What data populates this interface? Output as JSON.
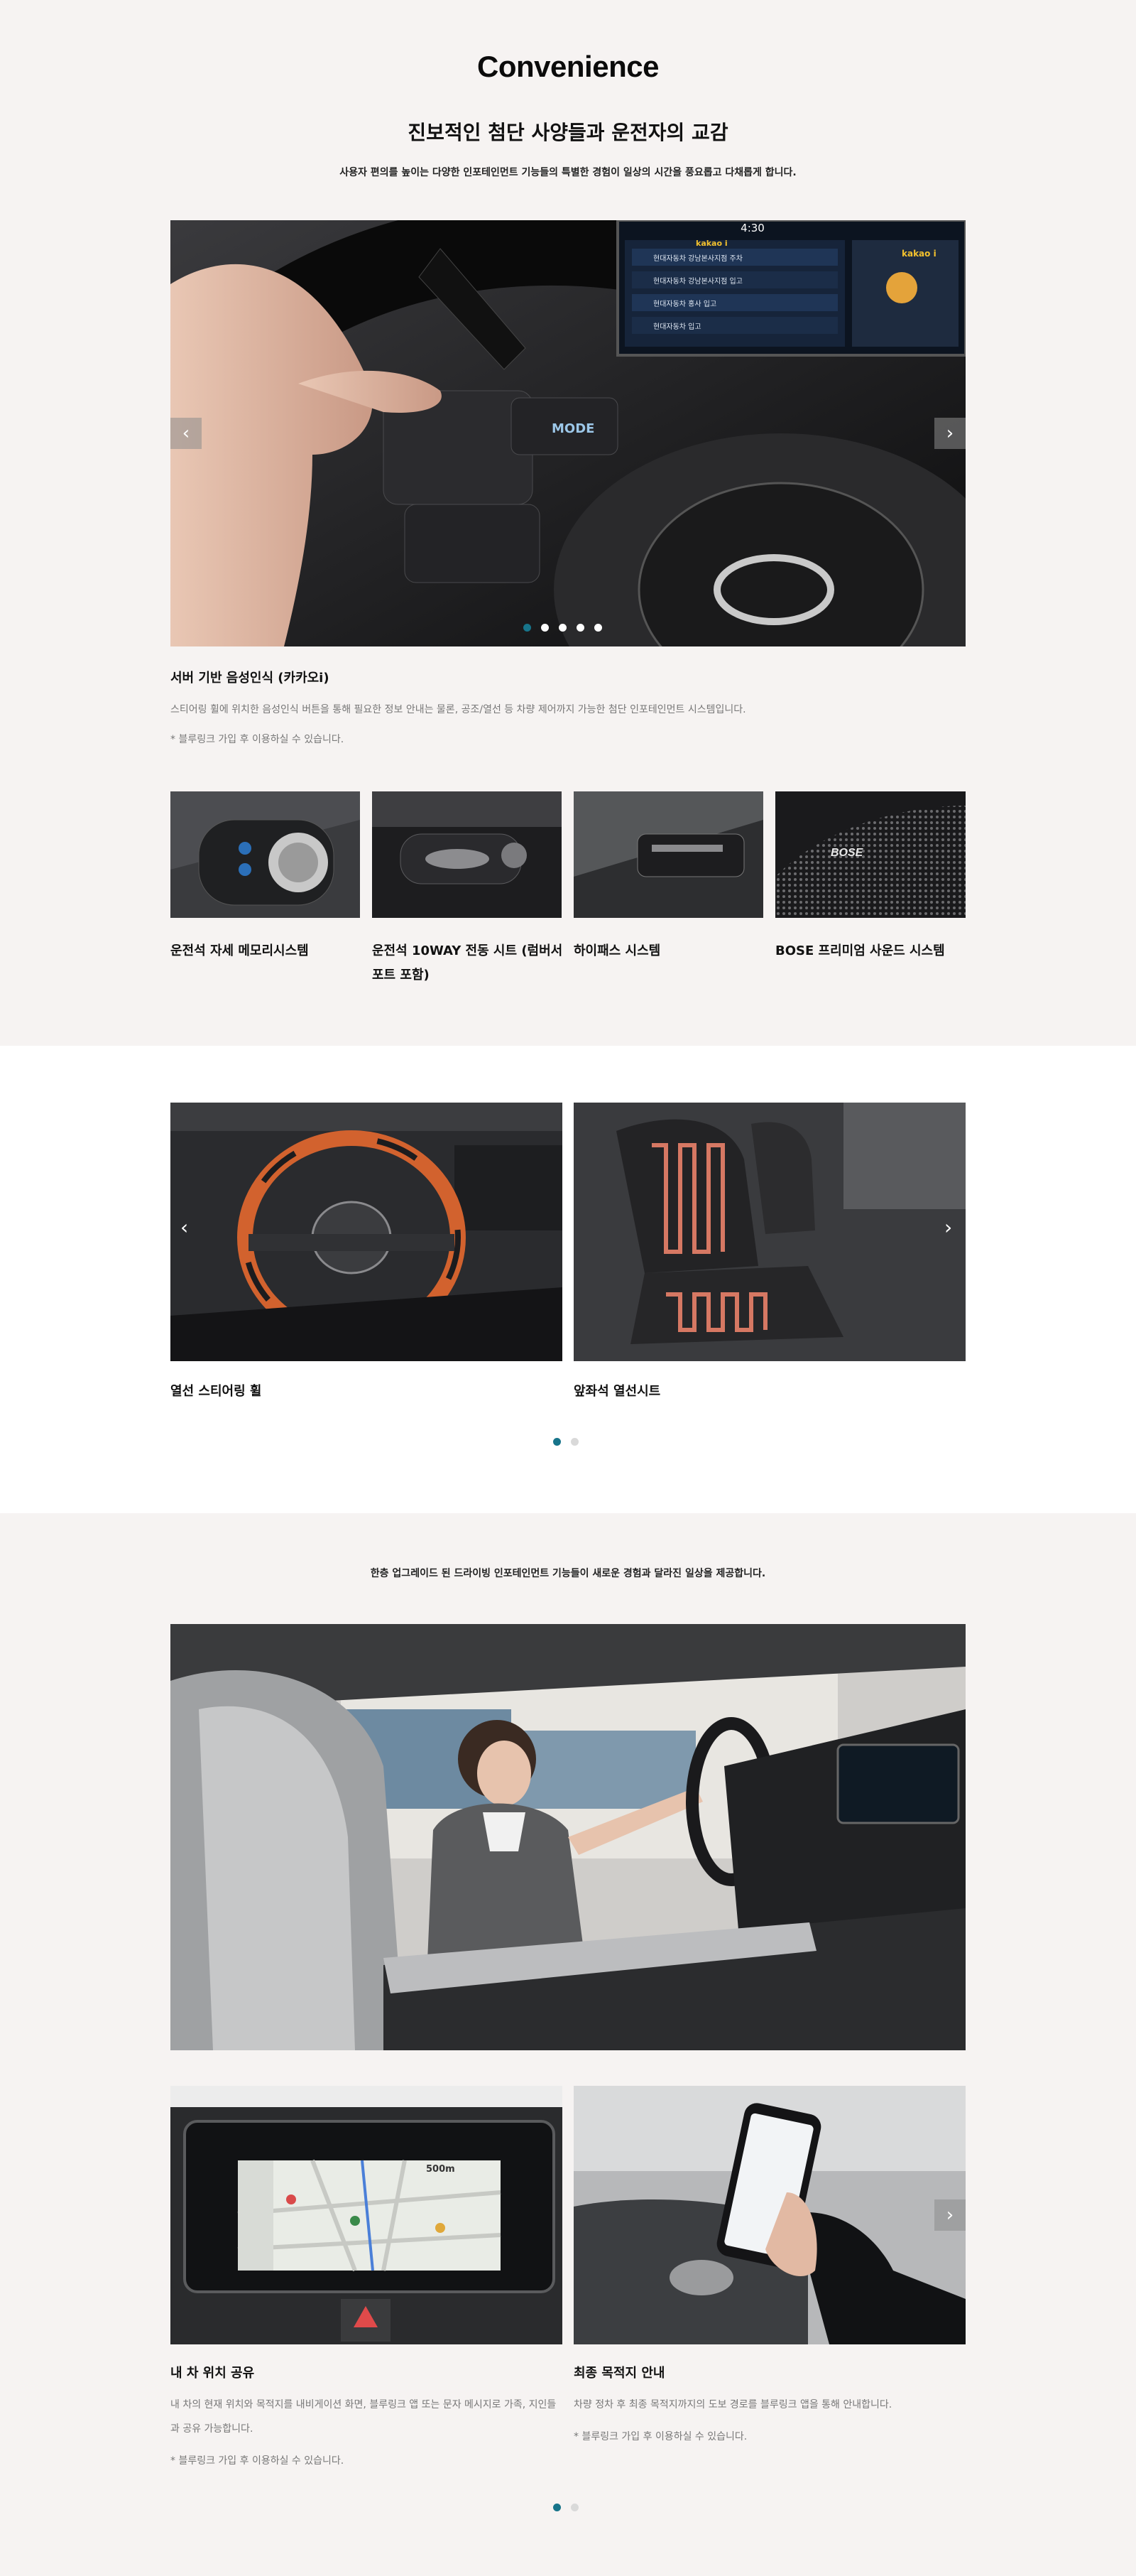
{
  "convenience": {
    "title": "Convenience",
    "subtitle": "진보적인 첨단 사양들과 운전자의 교감",
    "description": "사용자 편의를 높이는 다양한 인포테인먼트 기능들의 특별한 경험이 일상의 시간을 풍요롭고 다채롭게 합니다.",
    "slider": {
      "prev_icon": "‹",
      "next_icon": "›",
      "screen": {
        "time": "4:30",
        "brand": "kakao i",
        "items": [
          "현대자동차 강남본사지점 주차",
          "현대자동차 강남본사지점 입고",
          "현대자동차 홍사 입고",
          "현대자동차 입고"
        ]
      },
      "steering_label": "MODE",
      "dots_count": 5,
      "active_dot": 0
    },
    "feature": {
      "title": "서버 기반 음성인식 (카카오i)",
      "text": "스티어링 휠에 위치한 음성인식 버튼을 통해 필요한 정보 안내는 물론, 공조/열선 등 차량 제어까지 가능한 첨단 인포테인먼트 시스템입니다.",
      "note": "* 블루링크 가입 후 이용하실 수 있습니다."
    },
    "thumbnails": [
      {
        "label": "운전석 자세 메모리시스템"
      },
      {
        "label_line1": "운전석 10WAY 전동 시트 (럼버서",
        "label_line2": "포트 포함)"
      },
      {
        "label": "하이패스 시스템"
      },
      {
        "label": "BOSE 프리미엄 사운드 시스템",
        "badge": "BOSE"
      }
    ]
  },
  "heating": {
    "prev_icon": "‹",
    "next_icon": "›",
    "cards": [
      {
        "label": "열선 스티어링 휠"
      },
      {
        "label": "앞좌석 열선시트"
      }
    ],
    "dots_count": 2,
    "active_dot": 0
  },
  "infotainment": {
    "description": "한층 업그레이드 된 드라이빙 인포테인먼트 기능들이 새로운 경험과 달라진 일상을 제공합니다.",
    "prev_icon": "‹",
    "next_icon": "›",
    "nav_distance": "500m",
    "cards": [
      {
        "title": "내 차 위치 공유",
        "text_line1": "내 차의 현재 위치와 목적지를 내비게이션 화면, 블루링크 앱 또는 문자 메시지로 가족, 지인들",
        "text_line2": "과 공유 가능합니다.",
        "note": "* 블루링크 가입 후 이용하실 수 있습니다."
      },
      {
        "title": "최종 목적지 안내",
        "text_line1": "차량 정차 후 최종 목적지까지의 도보 경로를 블루링크 앱을 통해 안내합니다.",
        "note": "* 블루링크 가입 후 이용하실 수 있습니다."
      }
    ],
    "dots_count": 2,
    "active_dot": 0
  }
}
